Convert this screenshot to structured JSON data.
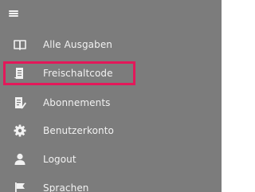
{
  "menu": {
    "items": [
      {
        "icon": "book-icon",
        "label": "Alle Ausgaben"
      },
      {
        "icon": "document-code-icon",
        "label": "Freischaltcode",
        "highlighted": true
      },
      {
        "icon": "document-edit-icon",
        "label": "Abonnements"
      },
      {
        "icon": "gear-icon",
        "label": "Benutzerkonto"
      },
      {
        "icon": "person-icon",
        "label": "Logout"
      },
      {
        "icon": "flag-icon",
        "label": "Sprachen"
      }
    ]
  },
  "colors": {
    "background": "#7c7c7c",
    "text": "#f2f2f2",
    "highlight": "#e3185a"
  }
}
